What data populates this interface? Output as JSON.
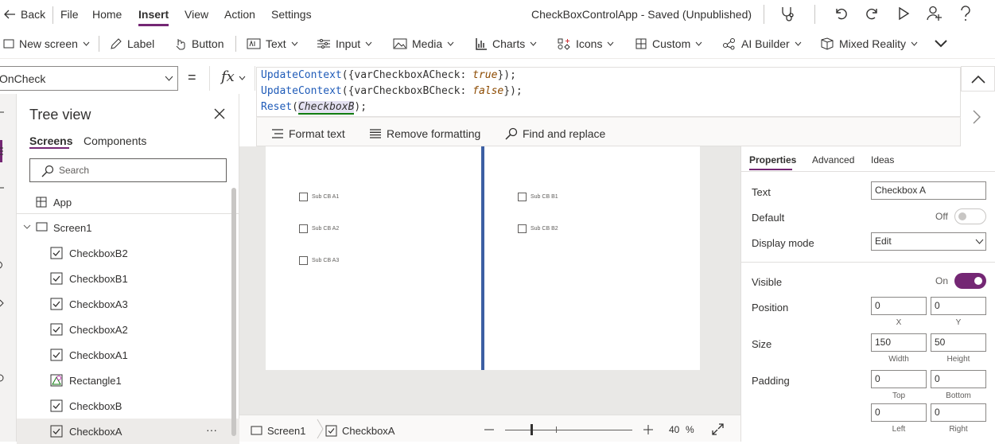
{
  "menubar": {
    "back": "Back",
    "items": [
      "File",
      "Home",
      "Insert",
      "View",
      "Action",
      "Settings"
    ],
    "active": "Insert",
    "app_title": "CheckBoxControlApp - Saved (Unpublished)"
  },
  "ribbon": {
    "new_screen": "New screen",
    "label": "Label",
    "button": "Button",
    "text": "Text",
    "input": "Input",
    "media": "Media",
    "charts": "Charts",
    "icons": "Icons",
    "custom": "Custom",
    "ai_builder": "AI Builder",
    "mixed_reality": "Mixed Reality"
  },
  "formula": {
    "property": "OnCheck",
    "fx": "fx",
    "equals": "=",
    "line1_fn": "UpdateContext",
    "line1_open": "({varCheckboxACheck: ",
    "line1_val": "true",
    "line1_close": "});",
    "line2_fn": "UpdateContext",
    "line2_open": "({varCheckboxBCheck: ",
    "line2_val": "false",
    "line2_close": "});",
    "line3_fn": "Reset",
    "line3_open": "(",
    "line3_arg": "CheckboxB",
    "line3_close": ");",
    "tools": [
      "Format text",
      "Remove formatting",
      "Find and replace"
    ]
  },
  "tree": {
    "title": "Tree view",
    "tabs": [
      "Screens",
      "Components"
    ],
    "search_placeholder": "Search",
    "app": "App",
    "screen": "Screen1",
    "items": [
      {
        "label": "CheckboxB2",
        "icon": "checkbox-icon"
      },
      {
        "label": "CheckboxB1",
        "icon": "checkbox-icon"
      },
      {
        "label": "CheckboxA3",
        "icon": "checkbox-icon"
      },
      {
        "label": "CheckboxA2",
        "icon": "checkbox-icon"
      },
      {
        "label": "CheckboxA1",
        "icon": "checkbox-icon"
      },
      {
        "label": "Rectangle1",
        "icon": "shapes-icon"
      },
      {
        "label": "CheckboxB",
        "icon": "checkbox-icon"
      },
      {
        "label": "CheckboxA",
        "icon": "checkbox-icon",
        "selected": true
      }
    ],
    "more": "···"
  },
  "canvas": {
    "left_boxes": [
      "Sub CB A1",
      "Sub CB A2",
      "Sub CB A3"
    ],
    "right_boxes": [
      "Sub CB B1",
      "Sub CB B2"
    ]
  },
  "status": {
    "screen": "Screen1",
    "control": "CheckboxA",
    "zoom_value": "40",
    "zoom_unit": "%",
    "zoom_level": 0.4
  },
  "props": {
    "tabs": [
      "Properties",
      "Advanced",
      "Ideas"
    ],
    "text_label": "Text",
    "text_value": "Checkbox A",
    "default_label": "Default",
    "default_state": "Off",
    "display_mode_label": "Display mode",
    "display_mode_value": "Edit",
    "visible_label": "Visible",
    "visible_state": "On",
    "position_label": "Position",
    "pos_x": "0",
    "pos_y": "0",
    "x_label": "X",
    "y_label": "Y",
    "size_label": "Size",
    "width": "150",
    "height": "50",
    "width_label": "Width",
    "height_label": "Height",
    "padding_label": "Padding",
    "pad_top": "0",
    "pad_bottom": "0",
    "pad_left": "0",
    "pad_right": "0",
    "top_label": "Top",
    "bottom_label": "Bottom",
    "left_label": "Left",
    "right_label": "Right"
  },
  "colors": {
    "accent": "#742774",
    "divider": "#3c5fa3",
    "toggle_on": "#742774"
  }
}
